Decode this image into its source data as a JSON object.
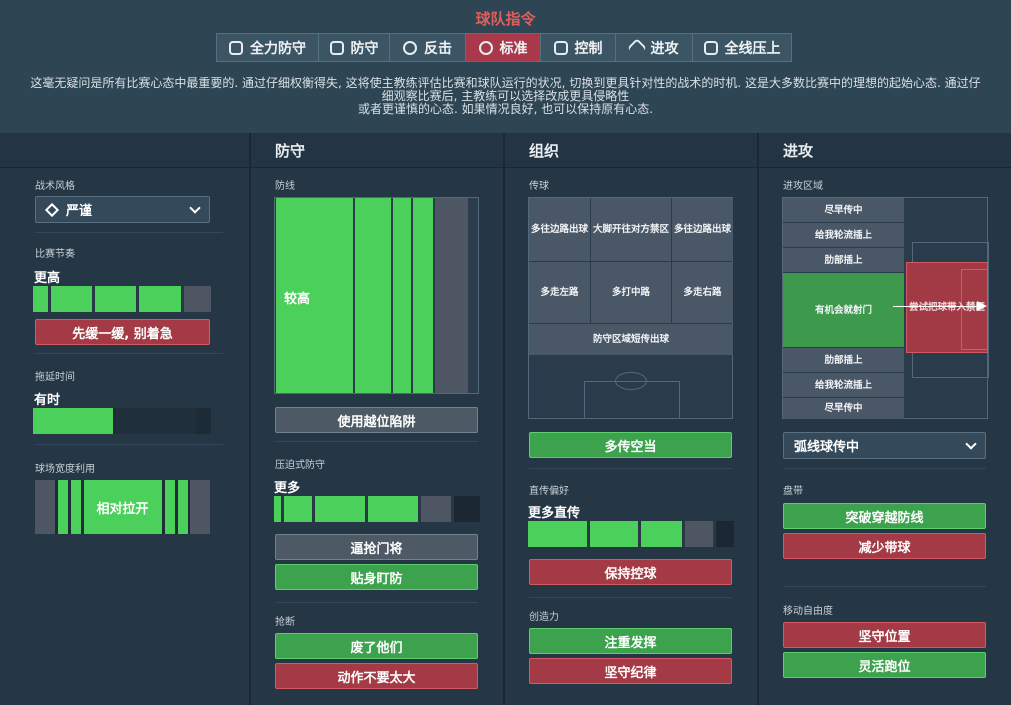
{
  "header": {
    "title": "球队指令",
    "modes": [
      {
        "label": "全力防守",
        "icon": "shield-wing-icon"
      },
      {
        "label": "防守",
        "icon": "shield-icon"
      },
      {
        "label": "反击",
        "icon": "counter-icon"
      },
      {
        "label": "标准",
        "icon": "balanced-icon"
      },
      {
        "label": "控制",
        "icon": "control-icon"
      },
      {
        "label": "进攻",
        "icon": "attack-arrow-icon"
      },
      {
        "label": "全线压上",
        "icon": "overload-icon"
      }
    ],
    "active_mode": "标准",
    "description_lines": [
      "这毫无疑问是所有比赛心态中最重要的. 通过仔细权衡得失, 这将使主教练评估比赛和球队运行的状况, 切换到更具针对性的战术的时机. 这是大多数比赛中的理想的起始心态. 通过仔",
      "细观察比赛后, 主教练可以选择改成更具侵略性",
      "或者更谨慎的心态. 如果情况良好, 也可以保持原有心态."
    ]
  },
  "general": {
    "style_label": "战术风格",
    "style_value": "严谨",
    "tempo_label": "比赛节奏",
    "tempo_value": "更高",
    "tempo_button": "先缓一缓, 别着急",
    "timewasting_label": "拖延时间",
    "timewasting_value": "有时",
    "width_label": "球场宽度利用",
    "width_value": "相对拉开"
  },
  "defence": {
    "heading": "防守",
    "line_label": "防线",
    "line_value": "较高",
    "offside_button": "使用越位陷阱",
    "press_label": "压迫式防守",
    "press_value": "更多",
    "press_btn1": "逼抢门将",
    "press_btn2": "贴身盯防",
    "tackle_label": "抢断",
    "tackle_btn1": "废了他们",
    "tackle_btn2": "动作不要太大"
  },
  "buildup": {
    "heading": "组织",
    "passing_label": "传球",
    "cells": {
      "c1": "多往边路出球",
      "c2": "大脚开往对方禁区",
      "c3": "多往边路出球",
      "c4": "多走左路",
      "c5": "多打中路",
      "c6": "多走右路",
      "c7": "防守区域短传出球"
    },
    "pass_btn": "多传空当",
    "directness_label": "直传偏好",
    "directness_value": "更多直传",
    "possession_btn": "保持控球",
    "creativity_label": "创造力",
    "creative_btn1": "注重发挥",
    "creative_btn2": "坚守纪律"
  },
  "attack": {
    "heading": "进攻",
    "zone_label": "进攻区域",
    "zones": {
      "z1": "尽早传中",
      "z2": "给我轮流插上",
      "z3": "肋部插上",
      "z4": "有机会就射门",
      "z5": "尝试把球带入禁区",
      "z6": "肋部插上",
      "z7": "给我轮流插上",
      "z8": "尽早传中"
    },
    "cross_dropdown": "弧线球传中",
    "dribble_label": "盘带",
    "dribble_btn1": "突破穿越防线",
    "dribble_btn2": "减少带球",
    "freedom_label": "移动自由度",
    "freedom_btn1": "坚守位置",
    "freedom_btn2": "灵活跑位"
  }
}
